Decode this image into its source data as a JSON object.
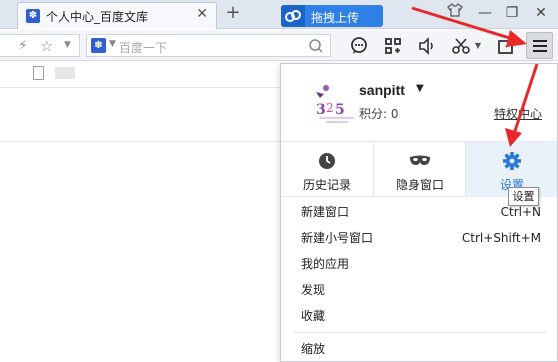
{
  "tab": {
    "title": "个人中心_百度文库",
    "close": "✕",
    "new_tab": "+"
  },
  "cloud_button": {
    "label": "拖拽上传"
  },
  "window_controls": {
    "minimize": "—",
    "restore": "❐",
    "close": "✕"
  },
  "toolbar": {
    "search_placeholder": "百度一下",
    "icons": [
      "lightning-icon",
      "star-icon",
      "chat-icon",
      "apps-icon",
      "volume-icon",
      "scissors-icon",
      "screenshot-icon",
      "menu-icon"
    ]
  },
  "menu": {
    "user": {
      "name": "sanpitt",
      "caret": "▼",
      "points": "积分: 0",
      "privilege_link": "特权中心"
    },
    "quick_actions": [
      {
        "label": "历史记录",
        "icon": "clock-icon"
      },
      {
        "label": "隐身窗口",
        "icon": "mask-icon"
      },
      {
        "label": "设置",
        "icon": "gear-icon"
      }
    ],
    "tooltip": "设置",
    "items": [
      {
        "label": "新建窗口",
        "shortcut": "Ctrl+N"
      },
      {
        "label": "新建小号窗口",
        "shortcut": "Ctrl+Shift+M"
      },
      {
        "label": "我的应用",
        "shortcut": ""
      },
      {
        "label": "发现",
        "shortcut": ""
      },
      {
        "label": "收藏",
        "shortcut": ""
      }
    ],
    "zoom_label": "缩放"
  },
  "colors": {
    "accent": "#2a79d8",
    "cloud_button": "#2f7fe6",
    "annotation_arrow": "#e8282b"
  }
}
